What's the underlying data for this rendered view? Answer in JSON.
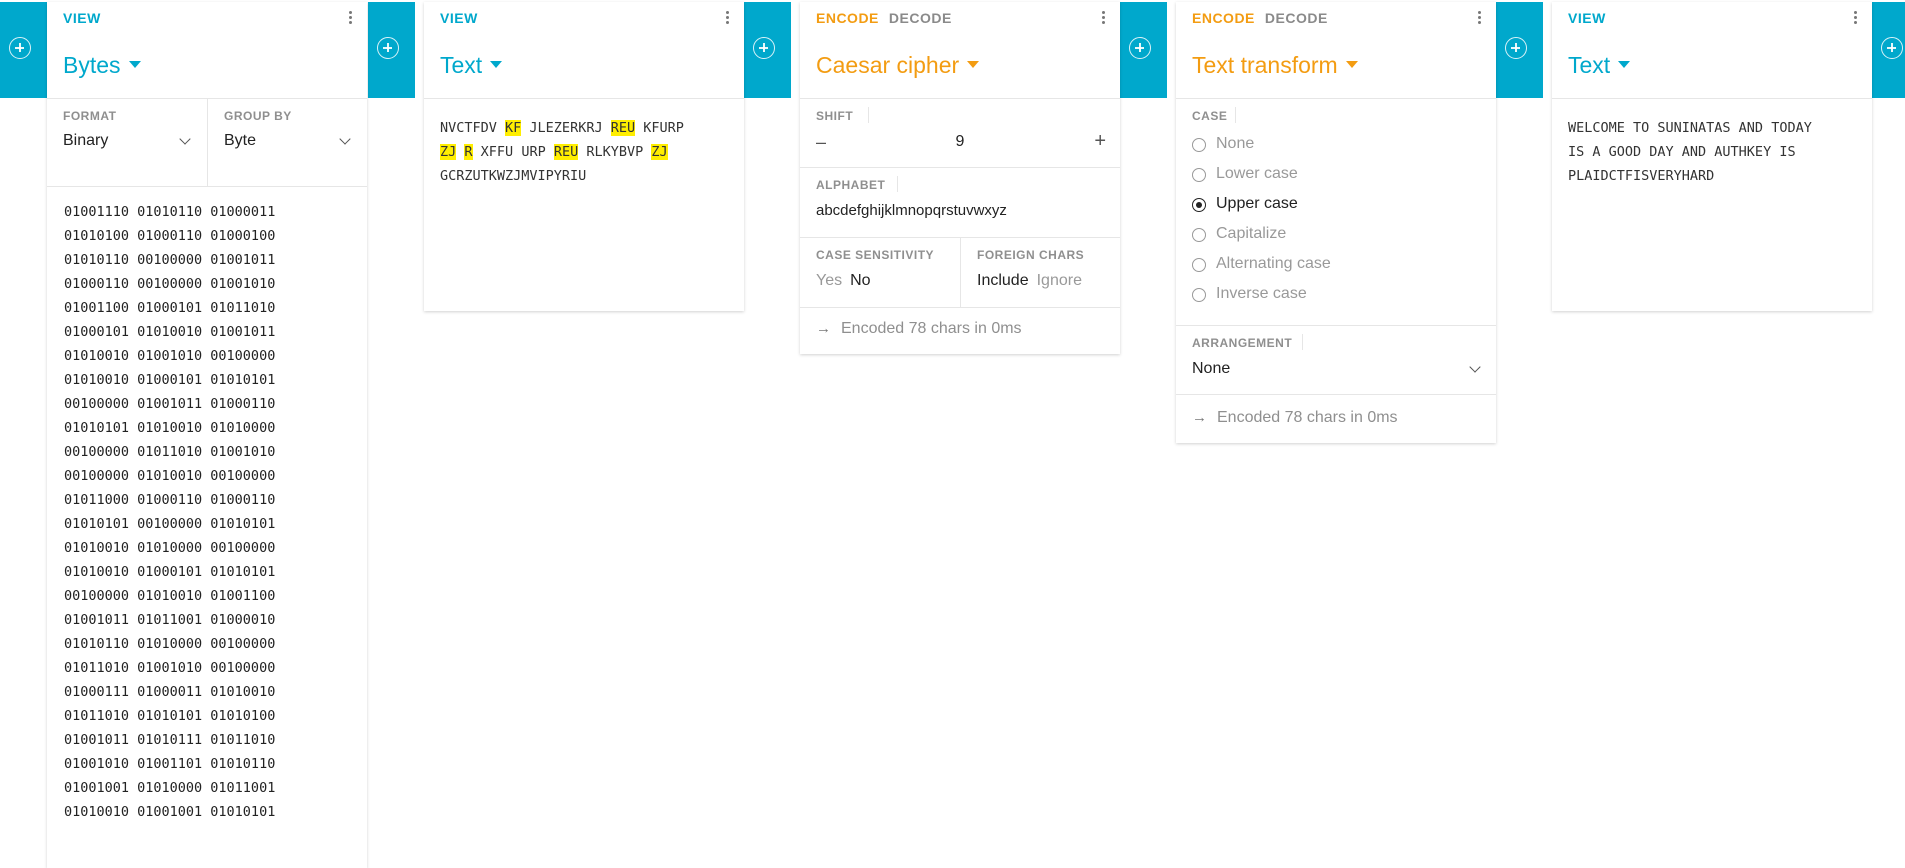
{
  "gutter_icon": "add-circle-icon",
  "cards": {
    "bytes": {
      "kind": "VIEW",
      "title": "Bytes",
      "format_label": "FORMAT",
      "format_value": "Binary",
      "group_label": "GROUP BY",
      "group_value": "Byte",
      "lines": [
        "01001110 01010110 01000011",
        "01010100 01000110 01000100",
        "01010110 00100000 01001011",
        "01000110 00100000 01001010",
        "01001100 01000101 01011010",
        "01000101 01010010 01001011",
        "01010010 01001010 00100000",
        "01010010 01000101 01010101",
        "00100000 01001011 01000110",
        "01010101 01010010 01010000",
        "00100000 01011010 01001010",
        "00100000 01010010 00100000",
        "01011000 01000110 01000110",
        "01010101 00100000 01010101",
        "01010010 01010000 00100000",
        "01010010 01000101 01010101",
        "00100000 01010010 01001100",
        "01001011 01011001 01000010",
        "01010110 01010000 00100000",
        "01011010 01001010 00100000",
        "01000111 01000011 01010010",
        "01011010 01010101 01010100",
        "01001011 01010111 01011010",
        "01001010 01001101 01010110",
        "01001001 01010000 01011001",
        "01010010 01001001 01010101"
      ]
    },
    "text_in": {
      "kind": "VIEW",
      "title": "Text",
      "content": {
        "t1": "NVCTFDV ",
        "h1": "KF",
        "t2": " JLEZERKRJ ",
        "h2": "REU",
        "t3": " KFURP",
        "h3": "ZJ",
        "t4": " ",
        "h4": "R",
        "t5": " XFFU URP ",
        "h5": "REU",
        "t6": " RLKYBVP ",
        "h6": "ZJ",
        "t7": "GCRZUTKWZJMVIPYRIU"
      }
    },
    "caesar": {
      "encode": "ENCODE",
      "decode": "DECODE",
      "title": "Caesar cipher",
      "shift_label": "SHIFT",
      "shift_minus": "–",
      "shift_value": "9",
      "shift_plus": "+",
      "alphabet_label": "ALPHABET",
      "alphabet_value": "abcdefghijklmnopqrstuvwxyz",
      "case_label": "CASE SENSITIVITY",
      "case_yes": "Yes",
      "case_no": "No",
      "foreign_label": "FOREIGN CHARS",
      "foreign_include": "Include",
      "foreign_ignore": "Ignore",
      "status_arrow": "→",
      "status": "Encoded 78 chars in 0ms"
    },
    "transform": {
      "encode": "ENCODE",
      "decode": "DECODE",
      "title": "Text transform",
      "case_label": "CASE",
      "options": [
        "None",
        "Lower case",
        "Upper case",
        "Capitalize",
        "Alternating case",
        "Inverse case"
      ],
      "selected": "Upper case",
      "arrangement_label": "ARRANGEMENT",
      "arrangement_value": "None",
      "status_arrow": "→",
      "status": "Encoded 78 chars in 0ms"
    },
    "text_out": {
      "kind": "VIEW",
      "title": "Text",
      "line1": "WELCOME TO SUNINATAS AND TODAY",
      "line2": "IS A GOOD DAY AND AUTHKEY IS",
      "line3": "PLAIDCTFISVERYHARD"
    }
  }
}
